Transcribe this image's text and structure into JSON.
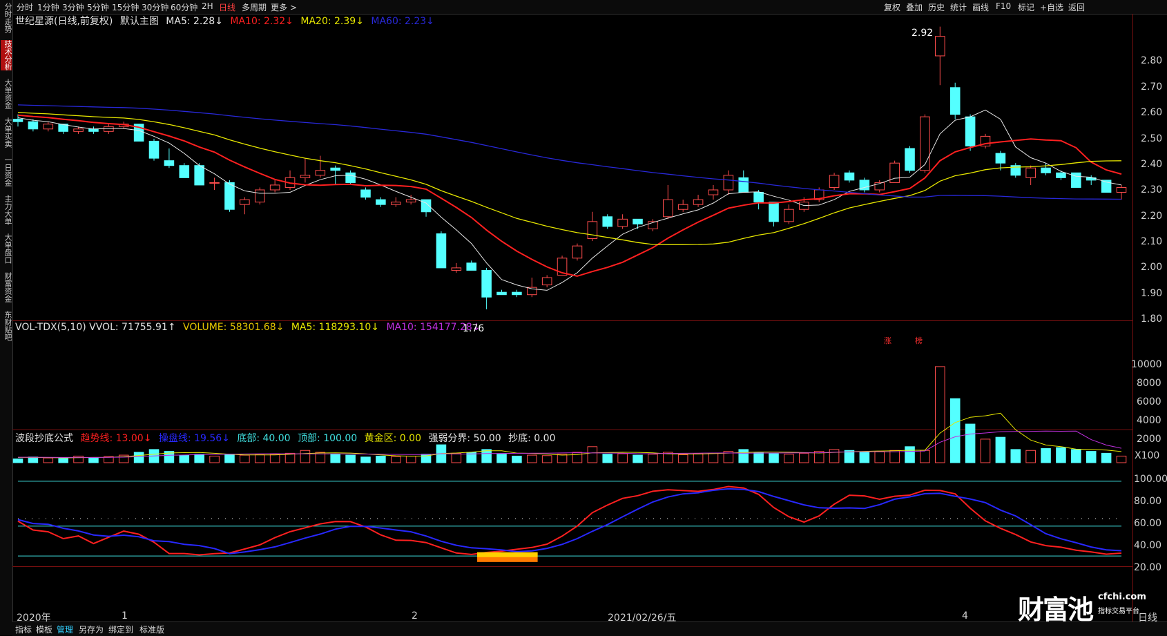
{
  "topbar": {
    "left": [
      "分时",
      "1分钟",
      "3分钟",
      "5分钟",
      "15分钟",
      "30分钟",
      "60分钟",
      "2H",
      "日线",
      "多周期",
      "更多 >"
    ],
    "active": "日线",
    "right": [
      "复权",
      "叠加",
      "历史",
      "统计",
      "画线",
      "F10",
      "标记",
      "+自选",
      "返回"
    ]
  },
  "leftnav": [
    "分时走势",
    "技术分析",
    "大单资金",
    "大单买卖",
    "一日资金",
    "主力大单",
    "大单盘口",
    "财富资金",
    "东财贴吧"
  ],
  "leftnav_active": "技术分析",
  "main_legend": {
    "name": "世纪星源(日线,前复权)",
    "template": "默认主图",
    "ma5": "MA5: 2.28↓",
    "ma10": "MA10: 2.32↓",
    "ma20": "MA20: 2.39↓",
    "ma60": "MA60: 2.23↓"
  },
  "vol_legend": {
    "name": "VOL-TDX(5,10) VVOL: 71755.91↑",
    "volume": "VOLUME: 58301.68↓",
    "ma5": "MA5: 118293.10↓",
    "ma10": "MA10: 154177.28↓"
  },
  "ind_legend": {
    "name": "波段抄底公式",
    "trend": "趋势线: 13.00↓",
    "control": "操盘线: 19.56↓",
    "bottom": "底部: 40.00",
    "top": "顶部: 100.00",
    "gold": "黄金区: 0.00",
    "weak": "强弱分界: 50.00",
    "buy": "抄底: 0.00"
  },
  "price_axis": [
    "2.80",
    "2.70",
    "2.60",
    "2.50",
    "2.40",
    "2.30",
    "2.20",
    "2.10",
    "2.00",
    "1.90",
    "1.80"
  ],
  "vol_axis": [
    "10000",
    "8000",
    "6000",
    "4000",
    "2000",
    "X100"
  ],
  "ind_axis": [
    "100.00",
    "80.00",
    "60.00",
    "40.00",
    "20.00"
  ],
  "x_axis": [
    "2020年",
    "1",
    "2",
    "2021/02/26/五",
    "4"
  ],
  "x_unit": "日线",
  "annotations": {
    "high": "2.92",
    "low": "1.76",
    "mark1": "涨",
    "mark2": "榜"
  },
  "bottombar": [
    "指标",
    "模板",
    "管理",
    "另存为",
    "绑定到",
    "标准版"
  ],
  "bottombar_active": "管理",
  "logo": {
    "main": "财富池",
    "url": "cfchi.com",
    "sub": "指标交易平台"
  },
  "colors": {
    "up": "#ff4d4d",
    "down": "#54ffff",
    "ma5": "#e6e6e6",
    "ma10": "#ff2020",
    "ma20": "#e6e600",
    "ma60": "#2828d8"
  },
  "chart_data": {
    "type": "candlestick",
    "price": {
      "ylim": [
        1.72,
        2.95
      ],
      "candles": [
        [
          2.54,
          2.53,
          2.56,
          2.51
        ],
        [
          2.53,
          2.5,
          2.54,
          2.49
        ],
        [
          2.5,
          2.52,
          2.53,
          2.49
        ],
        [
          2.52,
          2.49,
          2.52,
          2.48
        ],
        [
          2.49,
          2.5,
          2.51,
          2.48
        ],
        [
          2.5,
          2.49,
          2.51,
          2.48
        ],
        [
          2.49,
          2.51,
          2.52,
          2.48
        ],
        [
          2.51,
          2.52,
          2.53,
          2.5
        ],
        [
          2.52,
          2.45,
          2.52,
          2.45
        ],
        [
          2.45,
          2.38,
          2.46,
          2.37
        ],
        [
          2.37,
          2.35,
          2.42,
          2.34
        ],
        [
          2.35,
          2.3,
          2.36,
          2.3
        ],
        [
          2.35,
          2.27,
          2.36,
          2.27
        ],
        [
          2.28,
          2.28,
          2.3,
          2.25
        ],
        [
          2.28,
          2.17,
          2.29,
          2.16
        ],
        [
          2.19,
          2.21,
          2.22,
          2.15
        ],
        [
          2.2,
          2.25,
          2.26,
          2.19
        ],
        [
          2.25,
          2.27,
          2.29,
          2.24
        ],
        [
          2.26,
          2.3,
          2.33,
          2.25
        ],
        [
          2.3,
          2.31,
          2.38,
          2.28
        ],
        [
          2.31,
          2.33,
          2.39,
          2.3
        ],
        [
          2.34,
          2.33,
          2.35,
          2.27
        ],
        [
          2.32,
          2.28,
          2.33,
          2.27
        ],
        [
          2.25,
          2.22,
          2.26,
          2.21
        ],
        [
          2.21,
          2.19,
          2.22,
          2.18
        ],
        [
          2.19,
          2.2,
          2.22,
          2.18
        ],
        [
          2.2,
          2.21,
          2.23,
          2.19
        ],
        [
          2.21,
          2.16,
          2.21,
          2.14
        ],
        [
          2.07,
          1.93,
          2.08,
          1.93
        ],
        [
          1.92,
          1.93,
          1.95,
          1.91
        ],
        [
          1.95,
          1.92,
          1.96,
          1.92
        ],
        [
          1.92,
          1.81,
          1.93,
          1.76
        ],
        [
          1.83,
          1.82,
          1.84,
          1.82
        ],
        [
          1.83,
          1.82,
          1.84,
          1.81
        ],
        [
          1.82,
          1.85,
          1.89,
          1.81
        ],
        [
          1.86,
          1.89,
          1.9,
          1.85
        ],
        [
          1.9,
          1.97,
          1.98,
          1.9
        ],
        [
          1.97,
          2.02,
          2.03,
          1.96
        ],
        [
          2.05,
          2.12,
          2.16,
          2.04
        ],
        [
          2.14,
          2.1,
          2.15,
          2.09
        ],
        [
          2.1,
          2.13,
          2.15,
          2.09
        ],
        [
          2.13,
          2.11,
          2.12,
          2.09
        ],
        [
          2.09,
          2.12,
          2.13,
          2.08
        ],
        [
          2.14,
          2.21,
          2.27,
          2.13
        ],
        [
          2.17,
          2.19,
          2.21,
          2.16
        ],
        [
          2.19,
          2.21,
          2.23,
          2.18
        ],
        [
          2.23,
          2.25,
          2.27,
          2.21
        ],
        [
          2.25,
          2.31,
          2.33,
          2.23
        ],
        [
          2.3,
          2.24,
          2.33,
          2.24
        ],
        [
          2.24,
          2.2,
          2.25,
          2.17
        ],
        [
          2.2,
          2.12,
          2.2,
          2.1
        ],
        [
          2.12,
          2.17,
          2.19,
          2.11
        ],
        [
          2.17,
          2.2,
          2.22,
          2.16
        ],
        [
          2.21,
          2.25,
          2.26,
          2.2
        ],
        [
          2.26,
          2.31,
          2.32,
          2.25
        ],
        [
          2.32,
          2.29,
          2.33,
          2.28
        ],
        [
          2.29,
          2.25,
          2.3,
          2.24
        ],
        [
          2.25,
          2.28,
          2.29,
          2.24
        ],
        [
          2.28,
          2.36,
          2.37,
          2.28
        ],
        [
          2.42,
          2.33,
          2.43,
          2.32
        ],
        [
          2.33,
          2.55,
          2.56,
          2.32
        ],
        [
          2.8,
          2.88,
          2.92,
          2.68
        ],
        [
          2.67,
          2.56,
          2.69,
          2.54
        ],
        [
          2.55,
          2.43,
          2.56,
          2.41
        ],
        [
          2.43,
          2.47,
          2.48,
          2.42
        ],
        [
          2.4,
          2.36,
          2.41,
          2.33
        ],
        [
          2.35,
          2.31,
          2.36,
          2.3
        ],
        [
          2.3,
          2.34,
          2.35,
          2.27
        ],
        [
          2.34,
          2.32,
          2.36,
          2.31
        ],
        [
          2.32,
          2.3,
          2.33,
          2.29
        ],
        [
          2.32,
          2.26,
          2.32,
          2.26
        ],
        [
          2.3,
          2.29,
          2.31,
          2.27
        ],
        [
          2.29,
          2.24,
          2.29,
          2.24
        ],
        [
          2.24,
          2.26,
          2.27,
          2.21
        ]
      ]
    },
    "volume": {
      "ylim": [
        0,
        11000
      ],
      "values": [
        400,
        600,
        500,
        450,
        700,
        550,
        650,
        800,
        1100,
        1400,
        1200,
        800,
        900,
        700,
        900,
        800,
        850,
        900,
        1000,
        1300,
        1100,
        900,
        800,
        600,
        700,
        650,
        700,
        900,
        1900,
        1000,
        1100,
        1400,
        900,
        700,
        800,
        750,
        900,
        1100,
        1700,
        900,
        950,
        800,
        900,
        1100,
        850,
        950,
        1000,
        1200,
        1400,
        1100,
        950,
        900,
        1000,
        1200,
        1400,
        1300,
        1100,
        1200,
        1300,
        1700,
        1300,
        10200,
        6800,
        4100,
        2500,
        2700,
        1400,
        1300,
        1500,
        1600,
        1400,
        1200,
        1000,
        700
      ]
    },
    "indicator": {
      "ylim": [
        -10,
        110
      ]
    }
  }
}
